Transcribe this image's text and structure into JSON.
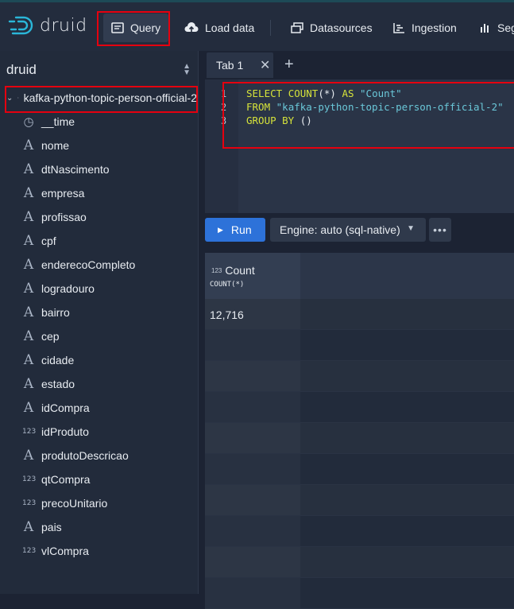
{
  "app": {
    "logo_text": "druid"
  },
  "nav": {
    "query": "Query",
    "load_data": "Load data",
    "datasources": "Datasources",
    "ingestion": "Ingestion",
    "segments": "Seg"
  },
  "sidebar": {
    "database": "druid",
    "table": "kafka-python-topic-person-official-2",
    "columns": [
      {
        "name": "__time",
        "type": "time"
      },
      {
        "name": "nome",
        "type": "string"
      },
      {
        "name": "dtNascimento",
        "type": "string"
      },
      {
        "name": "empresa",
        "type": "string"
      },
      {
        "name": "profissao",
        "type": "string"
      },
      {
        "name": "cpf",
        "type": "string"
      },
      {
        "name": "enderecoCompleto",
        "type": "string"
      },
      {
        "name": "logradouro",
        "type": "string"
      },
      {
        "name": "bairro",
        "type": "string"
      },
      {
        "name": "cep",
        "type": "string"
      },
      {
        "name": "cidade",
        "type": "string"
      },
      {
        "name": "estado",
        "type": "string"
      },
      {
        "name": "idCompra",
        "type": "string"
      },
      {
        "name": "idProduto",
        "type": "number"
      },
      {
        "name": "produtoDescricao",
        "type": "string"
      },
      {
        "name": "qtCompra",
        "type": "number"
      },
      {
        "name": "precoUnitario",
        "type": "number"
      },
      {
        "name": "pais",
        "type": "string"
      },
      {
        "name": "vlCompra",
        "type": "number"
      }
    ],
    "type_glyphs": {
      "string": "A",
      "number": "123",
      "time": "◷"
    }
  },
  "tabs": {
    "tab1": "Tab 1",
    "close": "✕",
    "add": "+"
  },
  "editor": {
    "line_numbers": [
      "1",
      "2",
      "3"
    ],
    "line1": {
      "kw1": "SELECT",
      "kw2": "COUNT",
      "p1": "(*)",
      "kw3": "AS",
      "s1": "\"Count\""
    },
    "line2": {
      "kw1": "FROM",
      "s1": "\"kafka-python-topic-person-official-2\""
    },
    "line3": {
      "kw1": "GROUP BY",
      "p1": "()"
    }
  },
  "toolbar": {
    "run_label": "Run",
    "engine_label": "Engine: auto (sql-native)",
    "more": "•••"
  },
  "results": {
    "column": {
      "type_badge": "123",
      "name": "Count",
      "expr": "COUNT(*)"
    },
    "rows": [
      "12,716"
    ]
  },
  "colors": {
    "accent": "#2d72d9",
    "highlight": "#e5000f",
    "keyword": "#d5e23a",
    "string": "#6ac7d8"
  }
}
